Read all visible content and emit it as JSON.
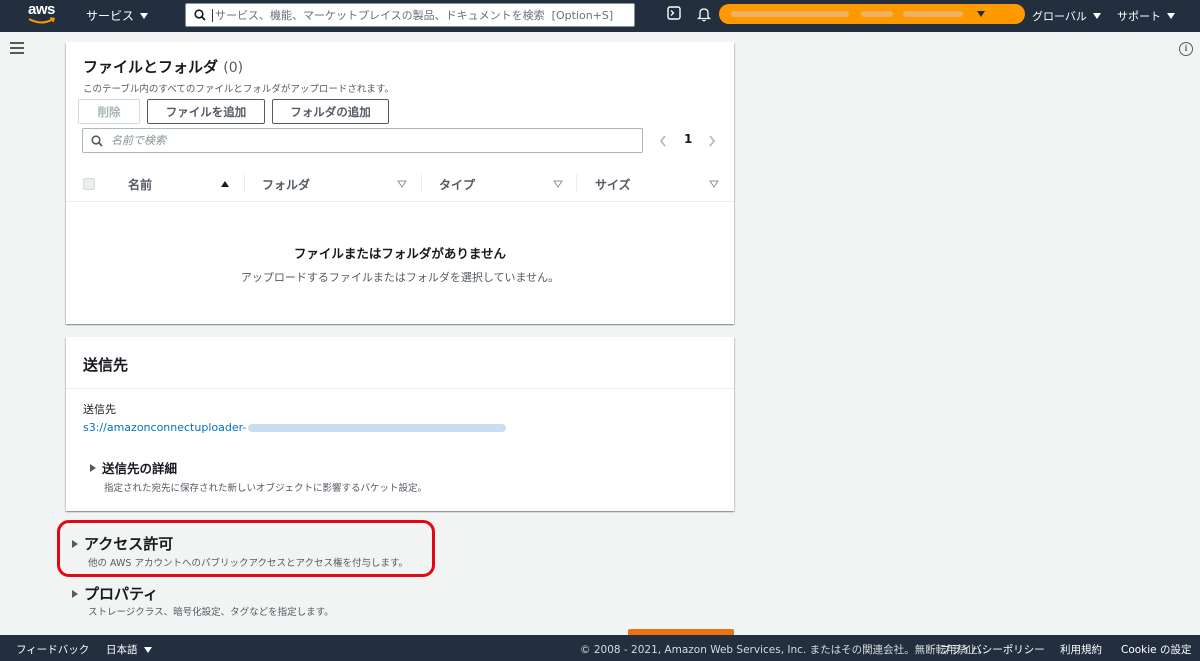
{
  "topnav": {
    "logo_text": "aws",
    "services_label": "サービス",
    "search_placeholder": "サービス、機能、マーケットプレイスの製品、ドキュメントを検索  [Option+S]",
    "global_label": "グローバル",
    "support_label": "サポート"
  },
  "files": {
    "title": "ファイルとフォルダ",
    "count": "(0)",
    "description": "このテーブル内のすべてのファイルとフォルダがアップロードされます。",
    "delete_label": "削除",
    "add_files_label": "ファイルを追加",
    "add_folder_label": "フォルダの追加",
    "filter_placeholder": "名前で検索",
    "page_number": "1",
    "columns": [
      "名前",
      "フォルダ",
      "タイプ",
      "サイズ"
    ],
    "empty_title": "ファイルまたはフォルダがありません",
    "empty_description": "アップロードするファイルまたはフォルダを選択していません。"
  },
  "destination": {
    "title": "送信先",
    "field_label": "送信先",
    "bucket_link": "s3://amazonconnectuploader-",
    "details_label": "送信先の詳細",
    "details_description": "指定された宛先に保存された新しいオブジェクトに影響するバケット設定。"
  },
  "access": {
    "title": "アクセス許可",
    "description": "他の AWS アカウントへのパブリックアクセスとアクセス権を付与します。"
  },
  "properties": {
    "title": "プロパティ",
    "description": "ストレージクラス、暗号化設定、タグなどを指定します。"
  },
  "footer": {
    "feedback": "フィードバック",
    "language": "日本語",
    "copyright": "© 2008 - 2021, Amazon Web Services, Inc. またはその関連会社。無断転用禁止。",
    "privacy": "プライバシーポリシー",
    "terms": "利用規約",
    "cookie": "Cookie の設定"
  },
  "colors": {
    "nav_bg": "#232f3e",
    "accent_orange": "#ff9900",
    "link_blue": "#0073bb",
    "highlight_red": "#e30613"
  }
}
